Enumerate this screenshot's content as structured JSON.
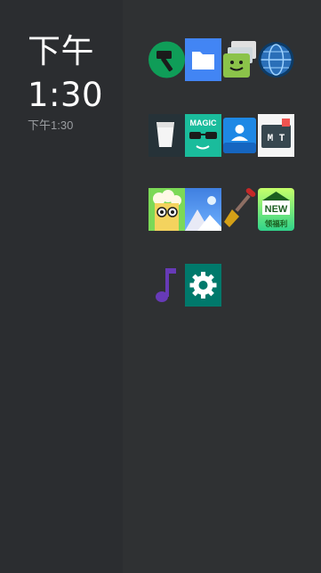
{
  "clock": {
    "line1": "下午",
    "line2": "1:30",
    "small": "下午1:30"
  },
  "apps": [
    {
      "row": 1,
      "icon": "hammer-icon",
      "color": "#0f9d58"
    },
    {
      "row": 1,
      "icon": "folder-icon",
      "color": "#4285f4"
    },
    {
      "row": 1,
      "icon": "messaging-icon",
      "color": "#8bc34a"
    },
    {
      "row": 1,
      "icon": "globe-browser-icon",
      "color": "#2a6fb8"
    },
    {
      "row": 2,
      "icon": "milk-glass-icon",
      "color": "#263238"
    },
    {
      "row": 2,
      "icon": "magic-sunglasses-icon",
      "color": "#1abc9c"
    },
    {
      "row": 2,
      "icon": "contacts-icon",
      "color": "#1e88e5"
    },
    {
      "row": 2,
      "icon": "mt-manager-icon",
      "color": "#f5f5f5"
    },
    {
      "row": 3,
      "icon": "popcorn-face-icon",
      "color": "#7cd957"
    },
    {
      "row": 3,
      "icon": "gallery-mountain-icon",
      "color": "#4a90e2"
    },
    {
      "row": 3,
      "icon": "shovel-icon",
      "color": "#c62828"
    },
    {
      "row": 3,
      "icon": "new-welfare-icon",
      "color": "#39e07a"
    },
    {
      "row": 4,
      "icon": "music-note-icon",
      "color": "#673ab7"
    },
    {
      "row": 4,
      "icon": "settings-gear-icon",
      "color": "#00796b"
    }
  ],
  "new_badge": {
    "text": "NEW",
    "subtitle": "领福利"
  },
  "magic_label": "MAGIC",
  "mt_label": "M T"
}
